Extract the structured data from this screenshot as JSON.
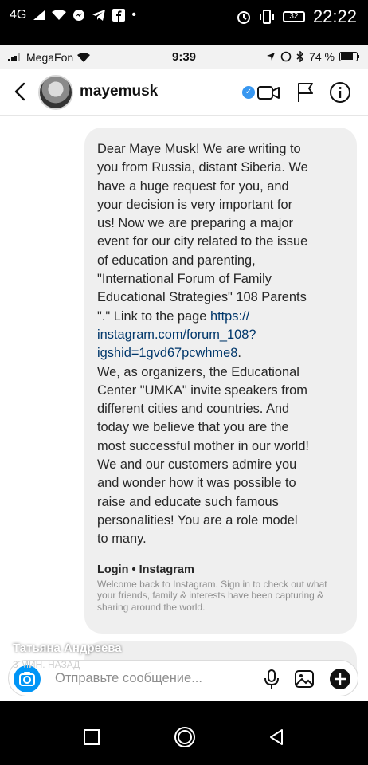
{
  "android_status": {
    "network": "4G",
    "time": "22:22",
    "battery": "32"
  },
  "ios_status": {
    "carrier": "MegaFon",
    "time": "9:39",
    "battery": "74 %"
  },
  "header": {
    "username": "mayemusk"
  },
  "message": {
    "part1": "Dear Maye Musk!  We are writing to\nyou from Russia, distant Siberia.  We\nhave a huge request for you, and\nyour decision is very important for\nus!  Now we are preparing a major\nevent for our city related to the issue\nof education and parenting,\n\"International Forum of Family\nEducational Strategies\" 108 Parents\n\".\"  Link to the page ",
    "link": "https://\ninstagram.com/forum_108?\nigshid=1gvd67pcwhme8",
    "part2": ".\nWe, as organizers, the Educational\nCenter \"UMKA\" invite speakers from\ndifferent cities and countries.  And\ntoday we believe that you are the\nmost successful mother in our world!\nWe and our customers admire you\nand wonder how it was possible to\nraise and educate such famous\npersonalities!  You are a role model\nto many."
  },
  "link_preview": {
    "title": "Login • Instagram",
    "description": "Welcome back to Instagram. Sign in to check out what your friends, family & interests have been capturing & sharing around the world."
  },
  "composer": {
    "placeholder": "Отправьте сообщение..."
  },
  "overlay": {
    "name": "Татьяна Андреева",
    "time_ago": "3 МИН. НАЗАД"
  },
  "colors": {
    "accent": "#0095f6",
    "verified": "#3897f0",
    "link": "#00376b",
    "bubble": "#efefef"
  }
}
